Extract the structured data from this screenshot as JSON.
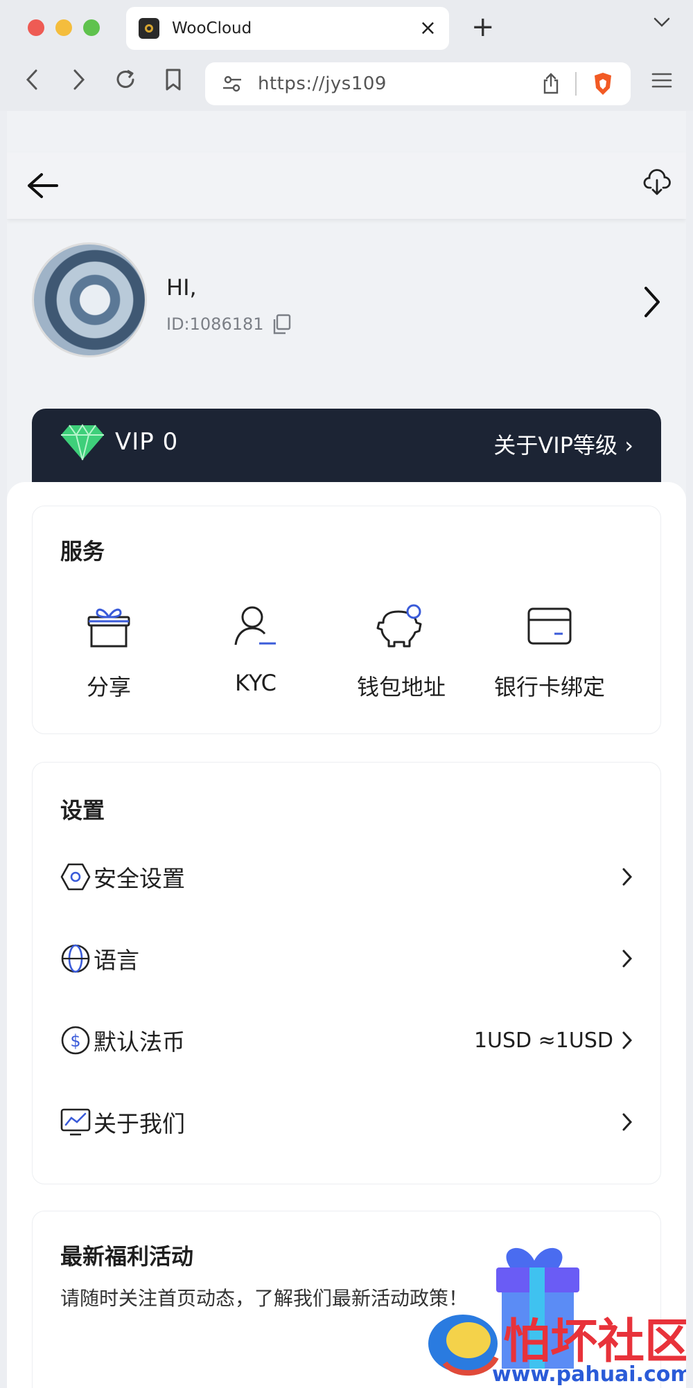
{
  "browser": {
    "tab_title": "WooCloud",
    "url": "https://jys109",
    "new_tab_glyph": "+",
    "close_glyph": "×"
  },
  "profile": {
    "greeting": "HI,",
    "user_id": "ID:1086181"
  },
  "vip": {
    "level_label": "VIP 0",
    "about_link": "关于VIP等级 ›"
  },
  "services": {
    "title": "服务",
    "items": [
      {
        "label": "分享",
        "icon": "gift-icon"
      },
      {
        "label": "KYC",
        "icon": "user-verify-icon"
      },
      {
        "label": "钱包地址",
        "icon": "piggy-bank-icon"
      },
      {
        "label": "银行卡绑定",
        "icon": "bank-card-icon"
      }
    ]
  },
  "settings": {
    "title": "设置",
    "items": [
      {
        "label": "安全设置",
        "value": "",
        "icon": "shield-hex-icon"
      },
      {
        "label": "语言",
        "value": "",
        "icon": "globe-icon"
      },
      {
        "label": "默认法币",
        "value": "1USD ≈1USD",
        "icon": "dollar-icon"
      },
      {
        "label": "关于我们",
        "value": "",
        "icon": "monitor-chart-icon"
      }
    ]
  },
  "promo": {
    "title": "最新福利活动",
    "subtitle": "请随时关注首页动态，了解我们最新活动政策！"
  },
  "watermark": {
    "text": "怕坏社区",
    "url": "www.pahuai.com"
  },
  "colors": {
    "vip_bar": "#1c2434",
    "accent_blue": "#3a5bd9",
    "gem_green": "#3ecf7a"
  }
}
